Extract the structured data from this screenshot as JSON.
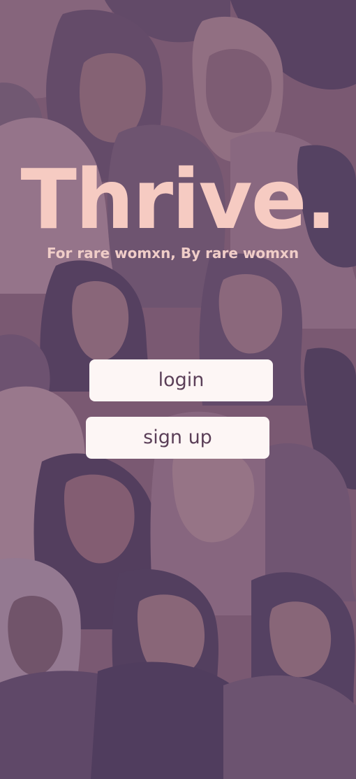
{
  "brand": {
    "title": "Thrive.",
    "tagline": "For rare womxn, By rare womxn"
  },
  "actions": {
    "login_label": "login",
    "signup_label": "sign up"
  },
  "colors": {
    "background": "#7a5a72",
    "title": "#f6cbc2",
    "button_bg": "#fdf6f5",
    "button_text": "#5b3f58"
  }
}
